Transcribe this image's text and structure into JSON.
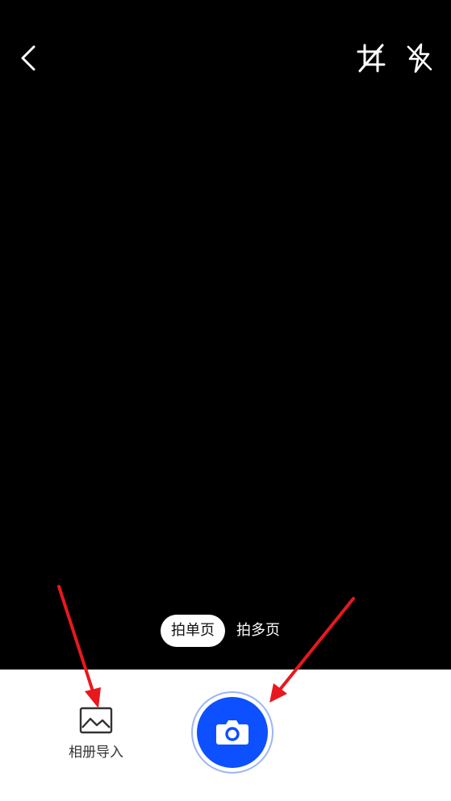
{
  "top_bar": {
    "back_icon": "chevron-left-icon",
    "crop_icon": "crop-icon",
    "flash_icon": "flash-off-icon"
  },
  "capture_modes": {
    "single": "拍单页",
    "multi": "拍多页",
    "selected": "single"
  },
  "bottom": {
    "album_label": "相册导入",
    "album_icon": "image-icon",
    "shutter_icon": "camera-icon",
    "accent_color": "#0d50ff"
  },
  "annotations": {
    "arrow_color": "#e8181d"
  }
}
